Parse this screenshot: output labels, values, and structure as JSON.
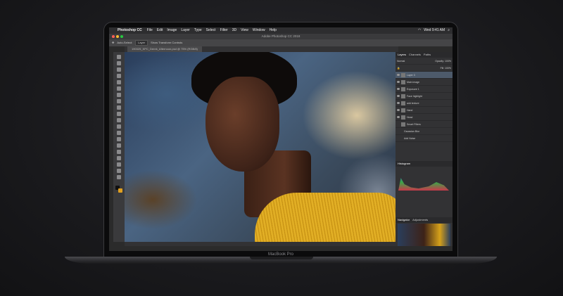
{
  "menubar": {
    "app": "Photoshop CC",
    "items": [
      "File",
      "Edit",
      "Image",
      "Layer",
      "Type",
      "Select",
      "Filter",
      "3D",
      "View",
      "Window",
      "Help"
    ],
    "clock": "Wed 9:41 AM"
  },
  "window": {
    "title": "Adobe Photoshop CC 2018"
  },
  "options": {
    "auto_select": "Auto-Select:",
    "auto_select_value": "Layer",
    "transform": "Show Transform Controls"
  },
  "document": {
    "tab": "190325_KPC_Derek_Afternoon.psd @ 75% (RGB/8)"
  },
  "panels": {
    "tabs": [
      "Layers",
      "Channels",
      "Paths"
    ],
    "blend_mode": "Normal",
    "opacity": "Opacity: 100%",
    "fill": "Fill: 100%",
    "layers": [
      "Layer 3",
      "Main image",
      "Exposure 1",
      "Face highlight",
      "add texture",
      "Hand",
      "Head",
      "Smart Filters",
      "Gaussian Blur",
      "Add Noise"
    ],
    "histogram": "Histogram",
    "navigator_tabs": [
      "Navigator",
      "Adjustments"
    ]
  },
  "laptop": {
    "label": "MacBook Pro"
  }
}
